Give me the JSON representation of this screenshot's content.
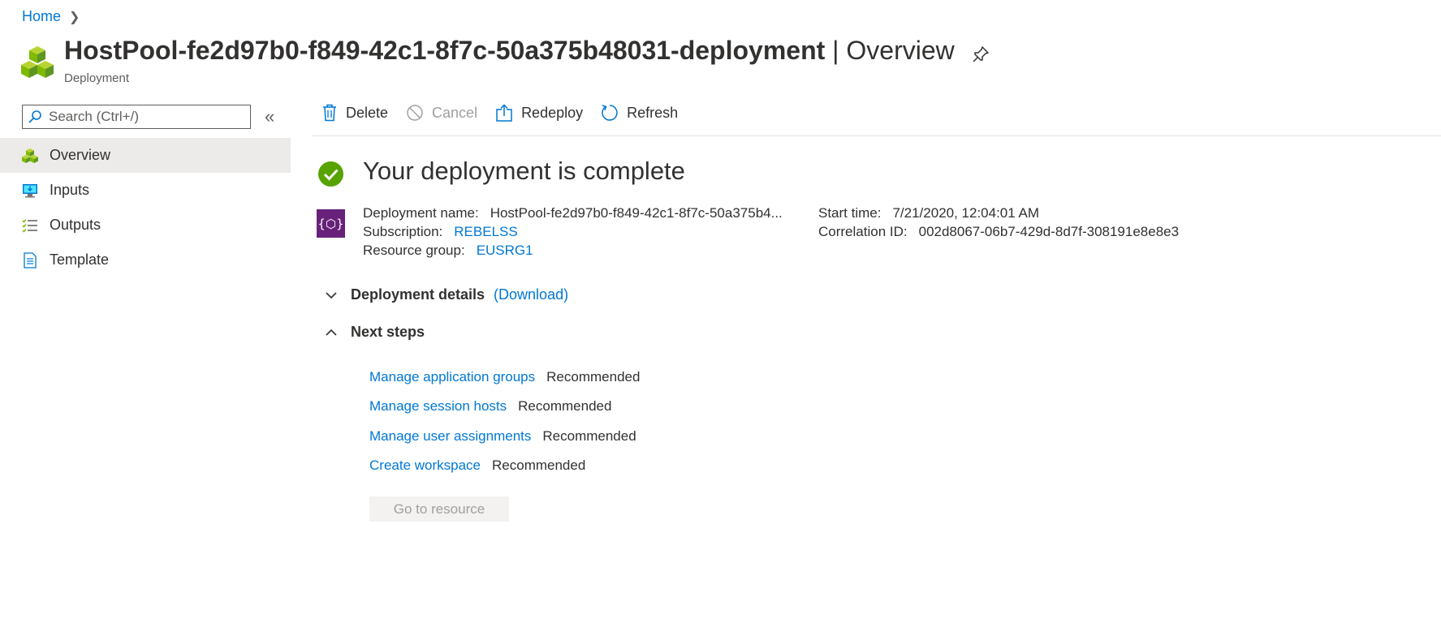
{
  "breadcrumb": {
    "home": "Home"
  },
  "header": {
    "name": "HostPool-fe2d97b0-f849-42c1-8f7c-50a375b48031-deployment",
    "separator": " | ",
    "page": "Overview",
    "subtitle": "Deployment"
  },
  "sidebar": {
    "search_placeholder": "Search (Ctrl+/)",
    "items": [
      {
        "label": "Overview",
        "icon": "overview-icon"
      },
      {
        "label": "Inputs",
        "icon": "inputs-icon"
      },
      {
        "label": "Outputs",
        "icon": "outputs-icon"
      },
      {
        "label": "Template",
        "icon": "template-icon"
      }
    ]
  },
  "toolbar": {
    "delete": "Delete",
    "cancel": "Cancel",
    "redeploy": "Redeploy",
    "refresh": "Refresh"
  },
  "status": {
    "title": "Your deployment is complete"
  },
  "info": {
    "deployment_name_label": "Deployment name:",
    "deployment_name_value": "HostPool-fe2d97b0-f849-42c1-8f7c-50a375b4...",
    "subscription_label": "Subscription:",
    "subscription_value": "REBELSS",
    "resource_group_label": "Resource group:",
    "resource_group_value": "EUSRG1",
    "start_time_label": "Start time:",
    "start_time_value": "7/21/2020, 12:04:01 AM",
    "correlation_label": "Correlation ID:",
    "correlation_value": "002d8067-06b7-429d-8d7f-308191e8e8e3"
  },
  "details": {
    "title": "Deployment details",
    "download": "(Download)"
  },
  "next_steps": {
    "title": "Next steps",
    "items": [
      {
        "link": "Manage application groups",
        "tag": "Recommended"
      },
      {
        "link": "Manage session hosts",
        "tag": "Recommended"
      },
      {
        "link": "Manage user assignments",
        "tag": "Recommended"
      },
      {
        "link": "Create workspace",
        "tag": "Recommended"
      }
    ],
    "goto_button": "Go to resource"
  },
  "colors": {
    "accent": "#0078d4",
    "success": "#57a300",
    "deploy_icon": "#68217a",
    "nav_active": "#edebe9"
  }
}
